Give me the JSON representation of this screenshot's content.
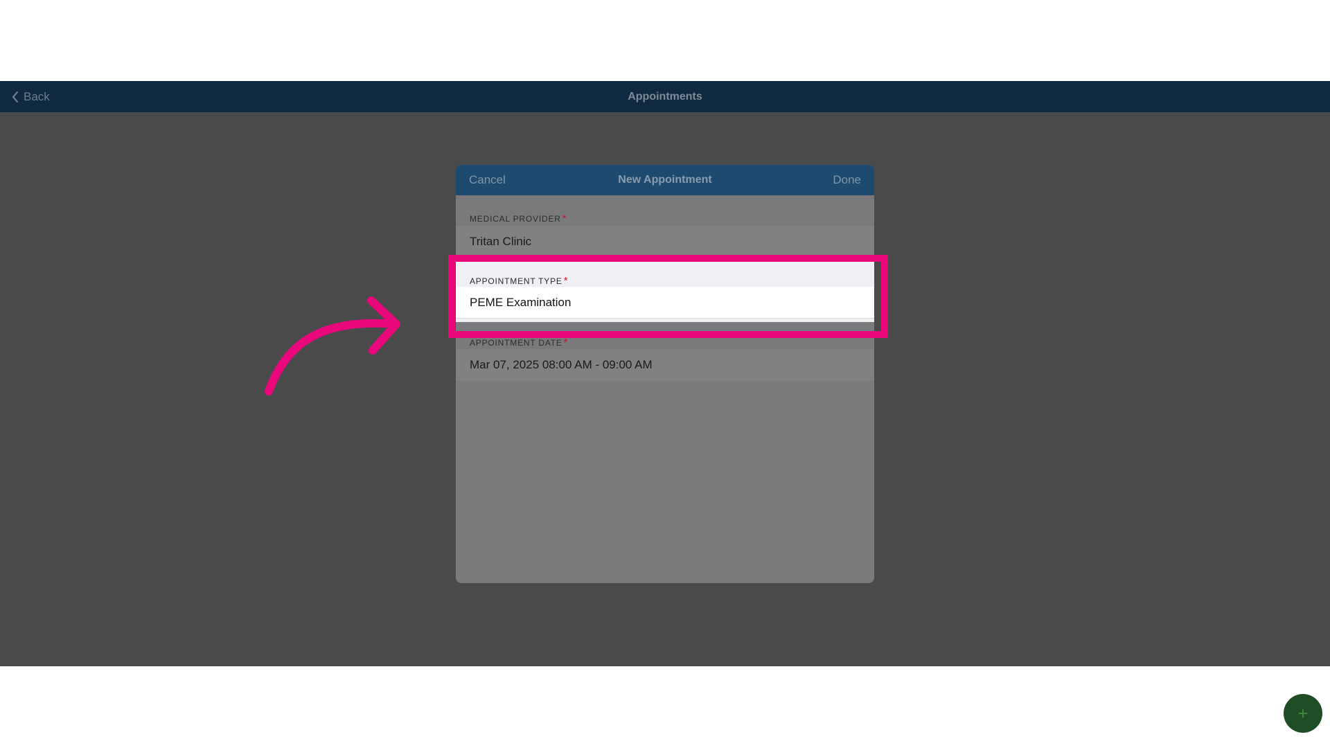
{
  "navbar": {
    "back_label": "Back",
    "title": "Appointments"
  },
  "modal": {
    "cancel_label": "Cancel",
    "title": "New Appointment",
    "done_label": "Done",
    "fields": [
      {
        "label": "MEDICAL PROVIDER",
        "required_mark": "*",
        "value": "Tritan Clinic"
      },
      {
        "label": "APPOINTMENT TYPE",
        "required_mark": "*",
        "value": "PEME Examination"
      },
      {
        "label": "APPOINTMENT DATE",
        "required_mark": "*",
        "value": "Mar 07, 2025 08:00 AM - 09:00 AM"
      }
    ]
  },
  "fab": {
    "icon": "plus-icon",
    "glyph": "+"
  },
  "annotation": {
    "icon": "curved-arrow-icon",
    "highlight_color": "#e8087c"
  },
  "colors": {
    "navbar": "#0f2940",
    "modal_header": "#1d4a6e",
    "overlay": "#4a4a4a",
    "required": "#c0172b",
    "fab": "#1f4d25"
  }
}
